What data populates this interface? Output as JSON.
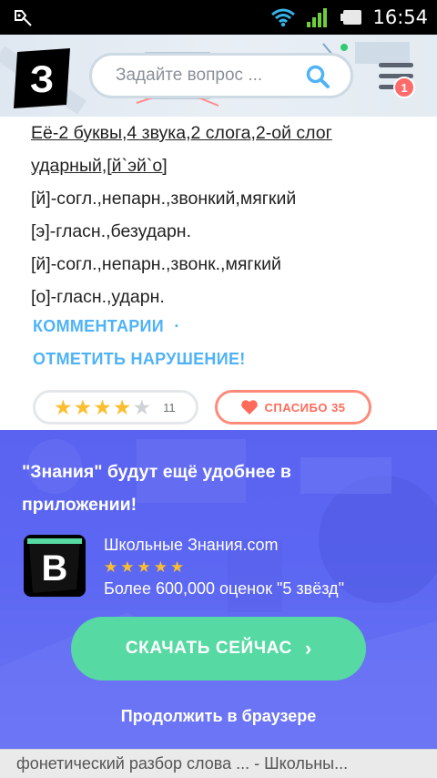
{
  "status_bar": {
    "time": "16:54",
    "icons": [
      "notification-icon",
      "wifi-icon",
      "signal-icon",
      "battery-icon"
    ]
  },
  "header": {
    "logo_letter": "З",
    "search_placeholder": "Задайте вопрос ...",
    "menu_badge": "1"
  },
  "answer": {
    "lines": [
      "Её-2 буквы,4 звука,2 слога,2-ой слог",
      "ударный,[й`эй`о]",
      "[й]-согл.,непарн.,звонкий,мягкий",
      "[э]-гласн.,безударн.",
      "[й]-согл.,непарн.,звонк.,мягкий",
      "[о]-гласн.,ударн."
    ],
    "comments_label": "КОММЕНТАРИИ",
    "comments_separator": "·",
    "report_label": "ОТМЕТИТЬ НАРУШЕНИЕ!",
    "rating_value": 4,
    "rating_max": 5,
    "rating_count": "11",
    "thanks_label": "СПАСИБО 35"
  },
  "promo": {
    "title": "\"Знания\" будут ещё удобнее в приложении!",
    "app_icon_letter": "B",
    "app_name": "Школьные Знания.com",
    "app_rating_stars": 5,
    "app_reviews": "Более 600,000 оценок \"5 звёзд\"",
    "download_label": "СКАЧАТЬ СЕЙЧАС",
    "continue_label": "Продолжить в браузере"
  },
  "browser": {
    "page_title": "фонетический разбор слова ... - Школьны..."
  },
  "colors": {
    "link": "#4fb3f6",
    "star": "#fbbe2e",
    "thanks": "#ff6b5a",
    "promo_bg": "#5a63ef",
    "download_button": "#57d9a3",
    "badge": "#ff6b6b"
  }
}
